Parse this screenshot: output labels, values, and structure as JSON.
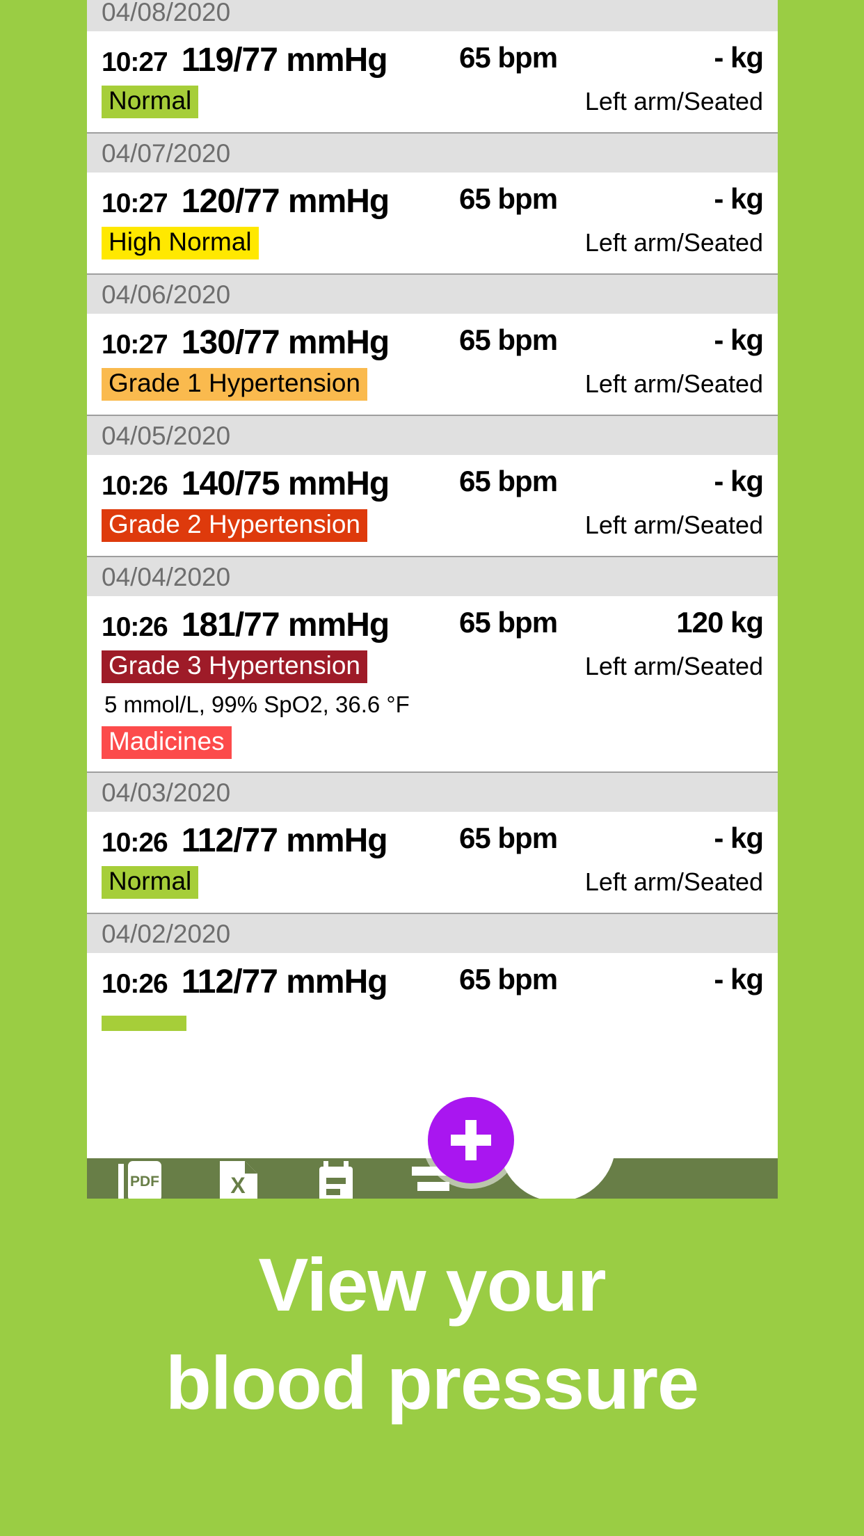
{
  "app": {
    "background_color": "#9ACD44",
    "card_background": "#ffffff",
    "toolbar_color": "#687E47",
    "fab_color": "#A916F0"
  },
  "caption": {
    "line1": "View your",
    "line2": "blood pressure"
  },
  "readings": [
    {
      "date": "04/08/2020",
      "time": "10:27",
      "bp": "119/77 mmHg",
      "pulse": "65 bpm",
      "weight": "- kg",
      "badge": "Normal",
      "badge_bg": "#A6CE39",
      "badge_color": "#000000",
      "posture": "Left arm/Seated"
    },
    {
      "date": "04/07/2020",
      "time": "10:27",
      "bp": "120/77 mmHg",
      "pulse": "65 bpm",
      "weight": "- kg",
      "badge": "High Normal",
      "badge_bg": "#FFE800",
      "badge_color": "#000000",
      "posture": "Left arm/Seated"
    },
    {
      "date": "04/06/2020",
      "time": "10:27",
      "bp": "130/77 mmHg",
      "pulse": "65 bpm",
      "weight": "- kg",
      "badge": "Grade 1 Hypertension",
      "badge_bg": "#FABA4E",
      "badge_color": "#000000",
      "posture": "Left arm/Seated"
    },
    {
      "date": "04/05/2020",
      "time": "10:26",
      "bp": "140/75 mmHg",
      "pulse": "65 bpm",
      "weight": "- kg",
      "badge": "Grade 2 Hypertension",
      "badge_bg": "#DE3A0C",
      "badge_color": "#ffffff",
      "posture": "Left arm/Seated"
    },
    {
      "date": "04/04/2020",
      "time": "10:26",
      "bp": "181/77 mmHg",
      "pulse": "65 bpm",
      "weight": "120 kg",
      "badge": "Grade 3 Hypertension",
      "badge_bg": "#9E1B28",
      "badge_color": "#ffffff",
      "posture": "Left arm/Seated",
      "extra": "5 mmol/L, 99% SpO2, 36.6 °F",
      "medicines_badge": "Madicines",
      "medicines_bg": "#FC4B4B",
      "medicines_color": "#ffffff"
    },
    {
      "date": "04/03/2020",
      "time": "10:26",
      "bp": "112/77 mmHg",
      "pulse": "65 bpm",
      "weight": "- kg",
      "badge": "Normal",
      "badge_bg": "#A6CE39",
      "badge_color": "#000000",
      "posture": "Left arm/Seated"
    },
    {
      "date": "04/02/2020",
      "time": "10:26",
      "bp": "112/77 mmHg",
      "pulse": "65 bpm",
      "weight": "- kg",
      "badge": "",
      "badge_bg": "#A6CE39",
      "badge_color": "#000000",
      "posture": ""
    }
  ],
  "toolbar": {
    "buttons": [
      {
        "name": "pdf-export-icon",
        "label": "PDF"
      },
      {
        "name": "excel-export-icon",
        "label": "X"
      },
      {
        "name": "note-icon",
        "label": ""
      },
      {
        "name": "list-icon",
        "label": ""
      }
    ]
  },
  "fab": {
    "label": "+",
    "name": "add-reading-button"
  }
}
